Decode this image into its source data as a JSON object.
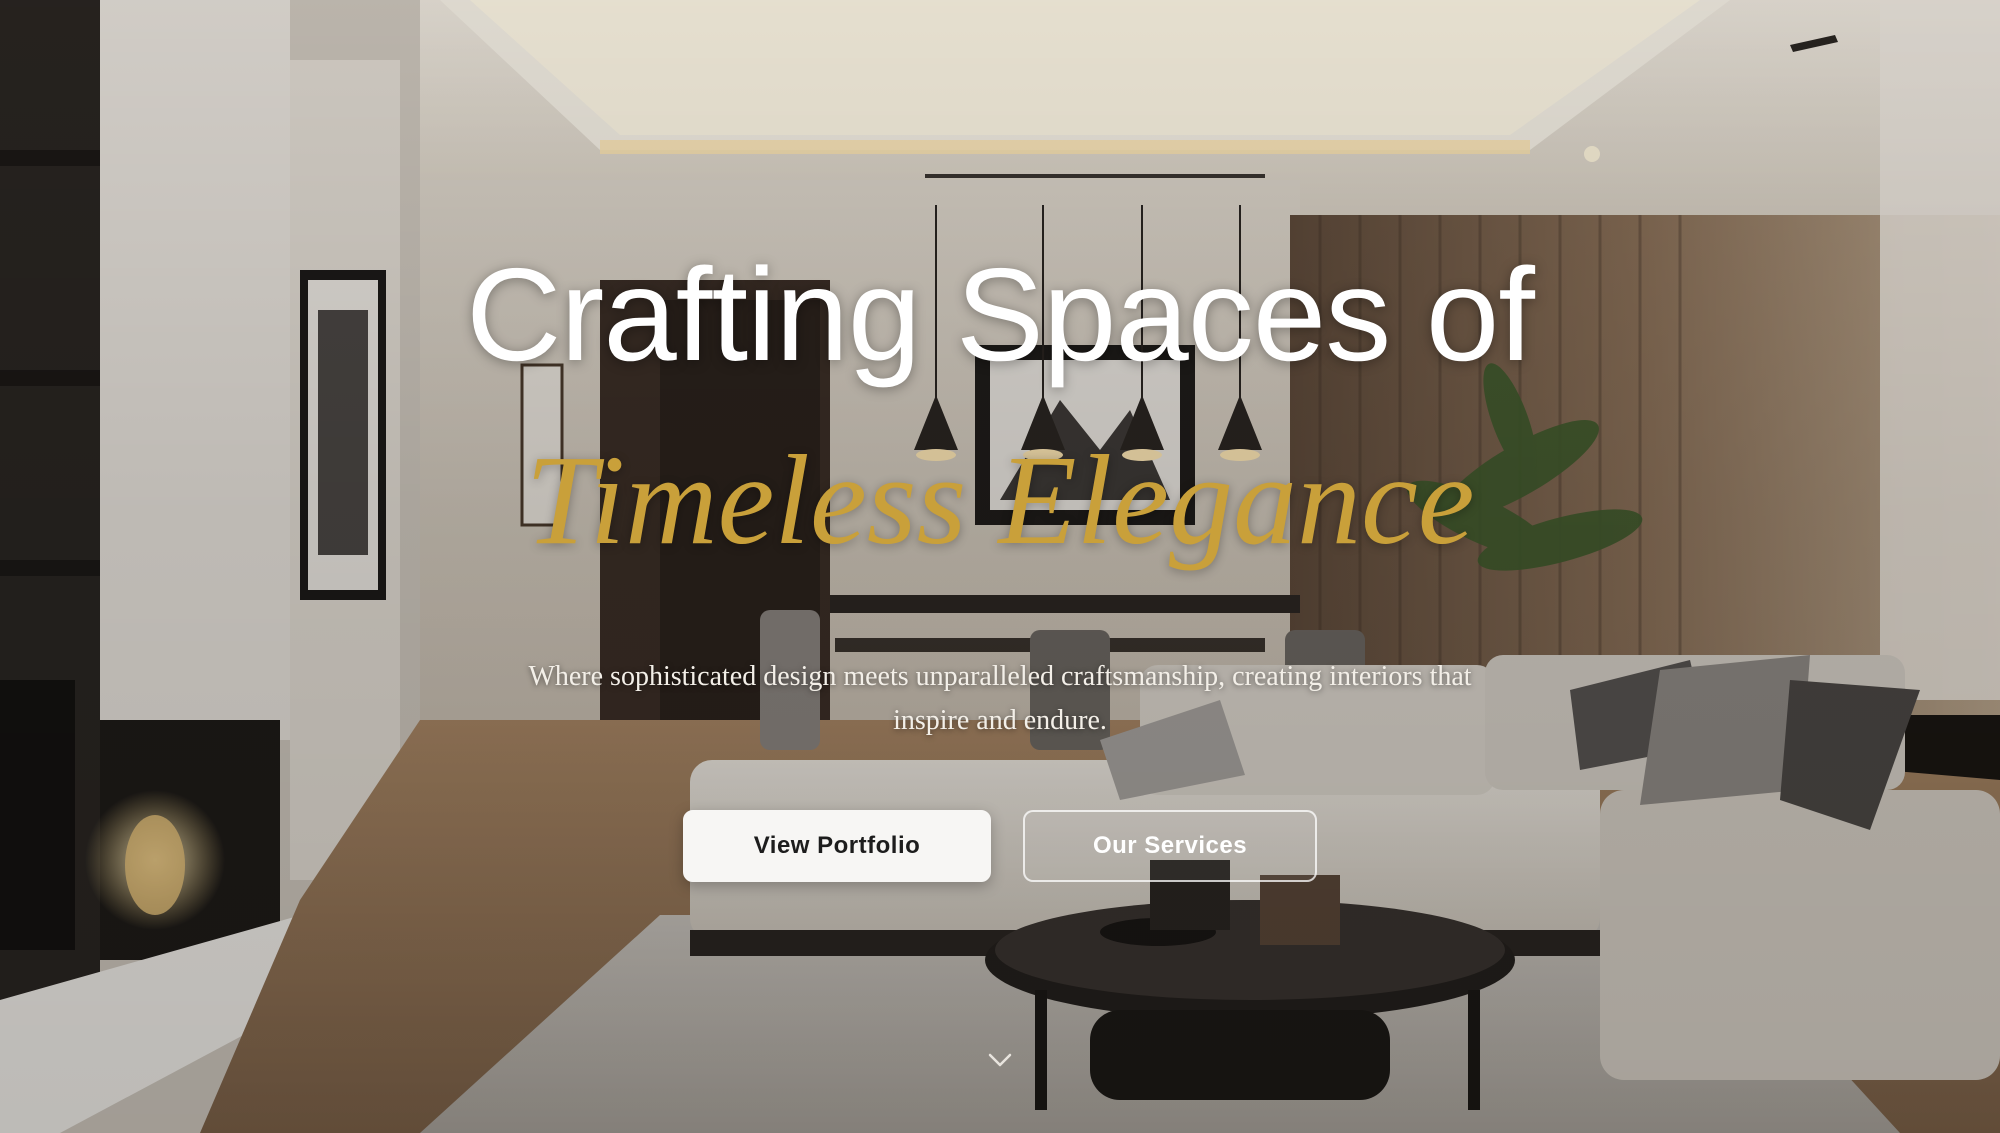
{
  "hero": {
    "title_line1": "Crafting Spaces of",
    "title_line2": "Timeless Elegance",
    "subtitle": "Where sophisticated design meets unparalleled craftsmanship, creating interiors that inspire and endure.",
    "primary_button": "View Portfolio",
    "secondary_button": "Our Services",
    "scroll_icon": "chevron-down-icon"
  },
  "colors": {
    "accent_gold": "#c9a03a",
    "title_white": "#ffffff",
    "primary_button_bg": "#f7f6f4"
  }
}
